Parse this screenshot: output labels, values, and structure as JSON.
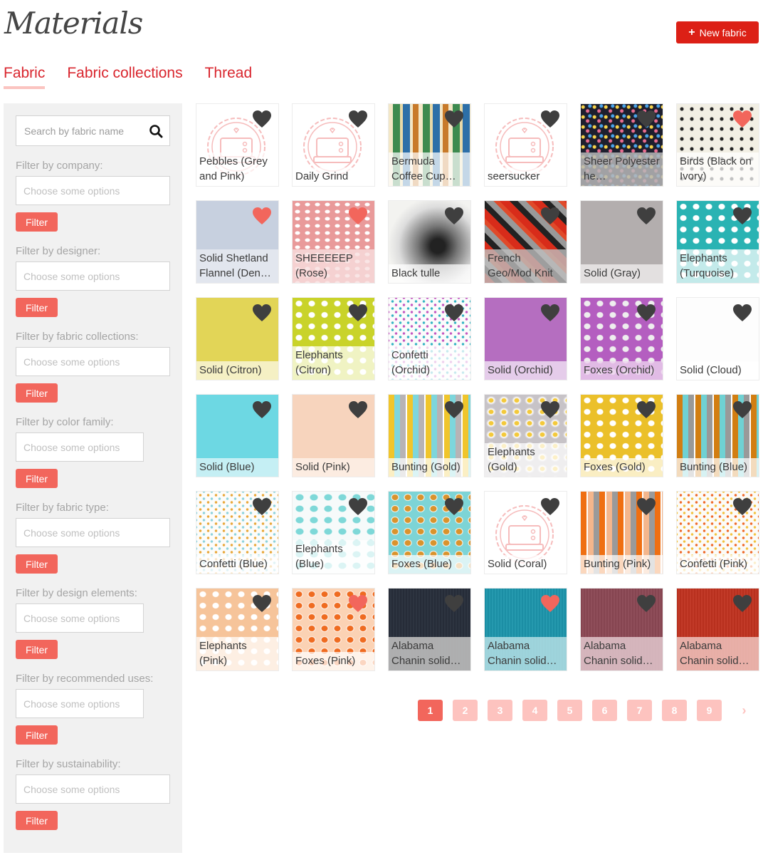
{
  "header": {
    "title": "Materials",
    "new_button_label": "New fabric",
    "new_button_icon": "plus-icon",
    "accent_color": "#dc2016"
  },
  "tabs": [
    {
      "label": "Fabric",
      "active": true
    },
    {
      "label": "Fabric collections",
      "active": false
    },
    {
      "label": "Thread",
      "active": false
    }
  ],
  "sidebar": {
    "search_placeholder": "Search by fabric name",
    "search_icon": "search-icon",
    "filter_button_label": "Filter",
    "filters": [
      {
        "label": "Filter by company:",
        "placeholder": "Choose some options"
      },
      {
        "label": "Filter by designer:",
        "placeholder": "Choose some options"
      },
      {
        "label": "Filter by fabric collections:",
        "placeholder": "Choose some options"
      },
      {
        "label": "Filter by color family:",
        "placeholder": "Choose some options"
      },
      {
        "label": "Filter by fabric type:",
        "placeholder": "Choose some options"
      },
      {
        "label": "Filter by design elements:",
        "placeholder": "Choose some options"
      },
      {
        "label": "Filter by recommended uses:",
        "placeholder": "Choose some options"
      },
      {
        "label": "Filter by sustainability:",
        "placeholder": "Choose some options"
      }
    ]
  },
  "fabrics": [
    {
      "name": "Pebbles (Grey and Pink)",
      "favorited": false,
      "swatch": "placeholder"
    },
    {
      "name": "Daily Grind",
      "favorited": false,
      "swatch": "placeholder"
    },
    {
      "name": "Bermuda Coffee Cup…",
      "favorited": false,
      "swatch": "coffee"
    },
    {
      "name": "seersucker",
      "favorited": false,
      "swatch": "placeholder"
    },
    {
      "name": "Sheer Polyester he…",
      "favorited": false,
      "swatch": "navy-hearts"
    },
    {
      "name": "Birds (Black on Ivory)",
      "favorited": true,
      "swatch": "birds"
    },
    {
      "name": "Solid Shetland Flannel (Den…",
      "favorited": true,
      "swatch": "denim"
    },
    {
      "name": "SHEEEEEP (Rose)",
      "favorited": true,
      "swatch": "rose-sheep"
    },
    {
      "name": "Black tulle",
      "favorited": false,
      "swatch": "tulle"
    },
    {
      "name": "French Geo/Mod Knit",
      "favorited": false,
      "swatch": "geo-knit"
    },
    {
      "name": "Solid (Gray)",
      "favorited": false,
      "swatch": "gray"
    },
    {
      "name": "Elephants (Turquoise)",
      "favorited": false,
      "swatch": "elephants-turquoise"
    },
    {
      "name": "Solid (Citron)",
      "favorited": false,
      "swatch": "citron"
    },
    {
      "name": "Elephants (Citron)",
      "favorited": false,
      "swatch": "elephants-citron"
    },
    {
      "name": "Confetti (Orchid)",
      "favorited": false,
      "swatch": "confetti-orchid"
    },
    {
      "name": "Solid (Orchid)",
      "favorited": false,
      "swatch": "orchid"
    },
    {
      "name": "Foxes (Orchid)",
      "favorited": false,
      "swatch": "foxes-orchid"
    },
    {
      "name": "Solid (Cloud)",
      "favorited": false,
      "swatch": "cloud"
    },
    {
      "name": "Solid (Blue)",
      "favorited": false,
      "swatch": "blue"
    },
    {
      "name": "Solid (Pink)",
      "favorited": false,
      "swatch": "pink"
    },
    {
      "name": "Bunting (Gold)",
      "favorited": false,
      "swatch": "bunting-gold"
    },
    {
      "name": "Elephants (Gold)",
      "favorited": false,
      "swatch": "elephants-gold"
    },
    {
      "name": "Foxes (Gold)",
      "favorited": false,
      "swatch": "foxes-gold"
    },
    {
      "name": "Bunting (Blue)",
      "favorited": false,
      "swatch": "bunting-blue"
    },
    {
      "name": "Confetti (Blue)",
      "favorited": false,
      "swatch": "confetti-blue"
    },
    {
      "name": "Elephants (Blue)",
      "favorited": false,
      "swatch": "elephants-blue"
    },
    {
      "name": "Foxes (Blue)",
      "favorited": false,
      "swatch": "foxes-blue"
    },
    {
      "name": "Solid (Coral)",
      "favorited": false,
      "swatch": "placeholder"
    },
    {
      "name": "Bunting (Pink)",
      "favorited": false,
      "swatch": "bunting-pink"
    },
    {
      "name": "Confetti (Pink)",
      "favorited": false,
      "swatch": "confetti-pink"
    },
    {
      "name": "Elephants (Pink)",
      "favorited": false,
      "swatch": "elephants-pink"
    },
    {
      "name": "Foxes (Pink)",
      "favorited": true,
      "swatch": "foxes-pink"
    },
    {
      "name": "Alabama Chanin solid…",
      "favorited": false,
      "swatch": "navy-jersey"
    },
    {
      "name": "Alabama Chanin solid…",
      "favorited": true,
      "swatch": "teal-jersey"
    },
    {
      "name": "Alabama Chanin solid…",
      "favorited": false,
      "swatch": "plum-jersey"
    },
    {
      "name": "Alabama Chanin solid…",
      "favorited": false,
      "swatch": "red-jersey"
    }
  ],
  "colors": {
    "heart_favorited": "#f2665c",
    "heart_default": "#3f3f3f",
    "page_active": "#f2665c",
    "page_inactive": "#fdc3bf"
  },
  "pagination": {
    "current": 1,
    "pages": [
      "1",
      "2",
      "3",
      "4",
      "5",
      "6",
      "7",
      "8",
      "9"
    ],
    "next_icon": "chevron-right-icon",
    "next_label": "›"
  }
}
